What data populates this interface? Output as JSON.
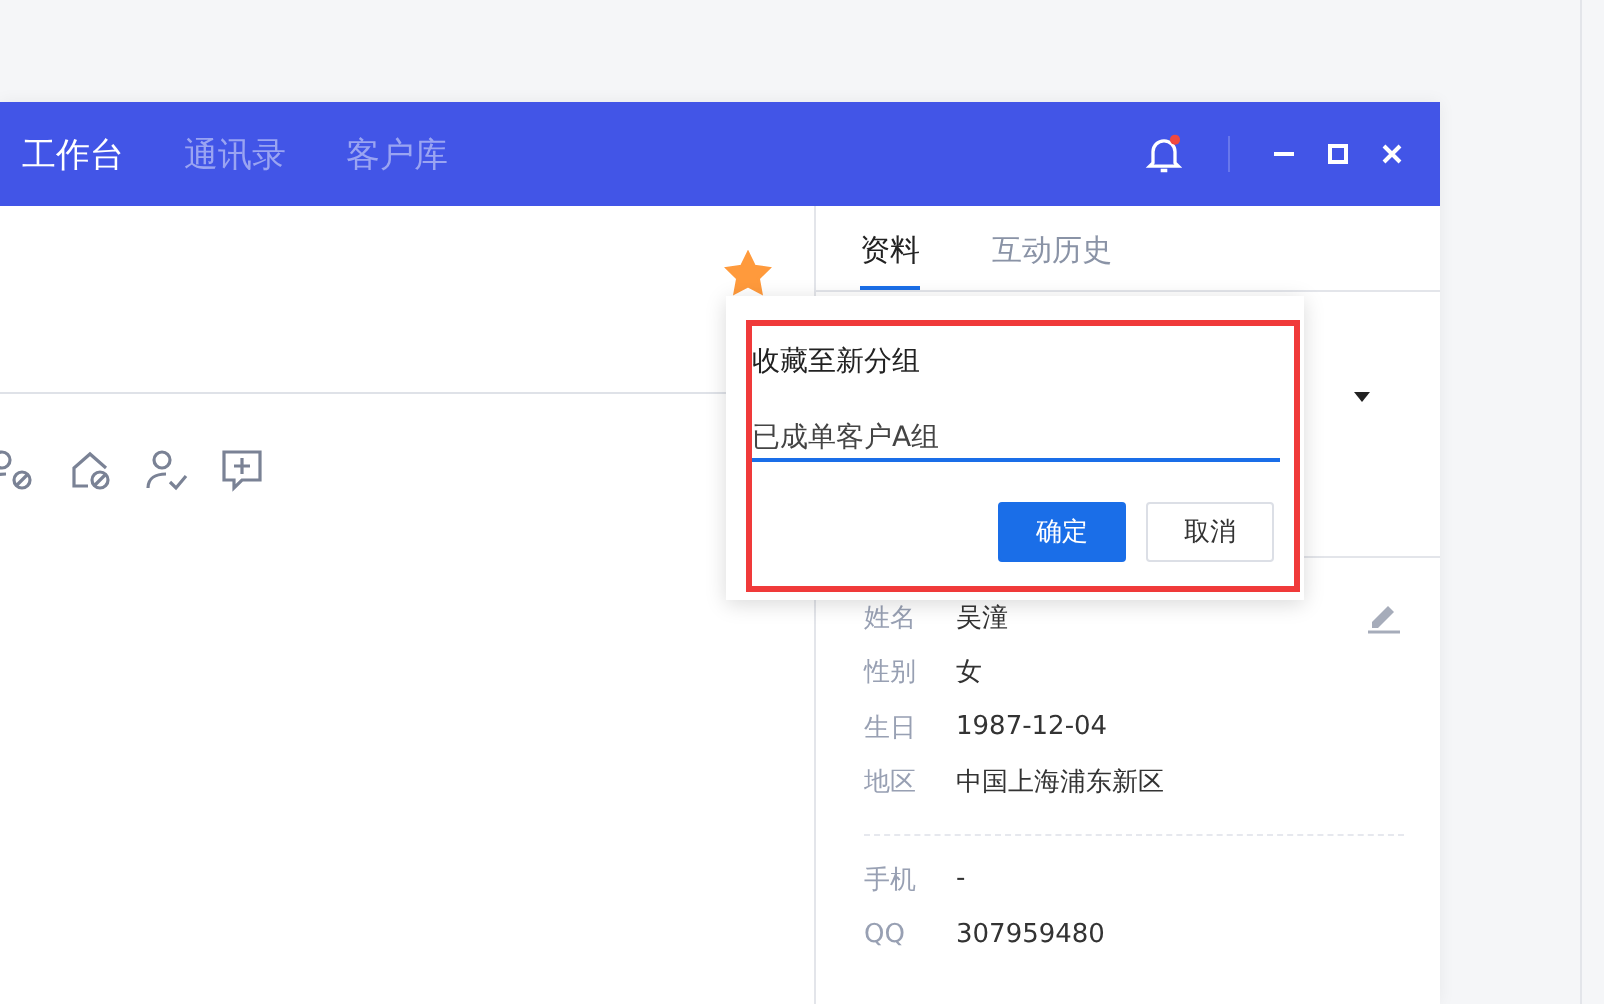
{
  "header": {
    "tabs": [
      {
        "label": "工作台",
        "selected": true
      },
      {
        "label": "通讯录",
        "selected": false
      },
      {
        "label": "客户库",
        "selected": false
      }
    ],
    "has_notification": true
  },
  "contact": {
    "favorited": true
  },
  "side_panel": {
    "tabs": [
      {
        "label": "资料",
        "selected": true
      },
      {
        "label": "互动历史",
        "selected": false
      }
    ],
    "groups": [
      [
        {
          "label": "姓名",
          "value": "吴潼"
        },
        {
          "label": "性别",
          "value": "女"
        },
        {
          "label": "生日",
          "value": "1987-12-04"
        },
        {
          "label": "地区",
          "value": "中国上海浦东新区"
        }
      ],
      [
        {
          "label": "手机",
          "value": "-"
        },
        {
          "label": "QQ",
          "value": "307959480"
        }
      ]
    ]
  },
  "favorite_popup": {
    "title": "收藏至新分组",
    "value": "已成单客户A组",
    "buttons": [
      {
        "label": "确定",
        "kind": "primary"
      },
      {
        "label": "取消",
        "kind": "secondary"
      }
    ]
  }
}
